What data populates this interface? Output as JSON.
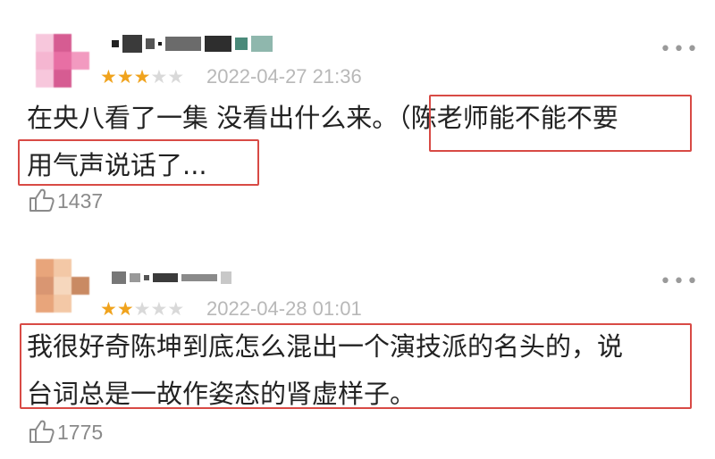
{
  "reviews": [
    {
      "stars_filled": 3,
      "stars_total": 5,
      "date": "2022-04-27 21:36",
      "text_line1": "在央八看了一集 没看出什么来。（陈老师能不能不要",
      "text_line2": "用气声说话了...",
      "likes": "1437",
      "more_label": "•••",
      "avatar_colors": [
        "#f7c7dc",
        "#f29ac0",
        "#e86fa4",
        "#f5b6d1",
        "#ee86b4",
        "#d65c92"
      ],
      "name_mosaic_colors": [
        "#222222",
        "#3a3a3a",
        "#555555",
        "#1a1a1a",
        "#6b6b6b",
        "#2e2e2e",
        "#4a8a7a",
        "#8fb7ad"
      ]
    },
    {
      "stars_filled": 2,
      "stars_total": 5,
      "date": "2022-04-28 01:01",
      "text_line1": "我很好奇陈坤到底怎么混出一个演技派的名头的，说",
      "text_line2": "台词总是一故作姿态的肾虚样子。",
      "likes": "1775",
      "more_label": "•••",
      "avatar_colors": [
        "#f3c8a6",
        "#e8a57b",
        "#c98a63",
        "#f6d7bd",
        "#d99672",
        "#b7775a"
      ],
      "name_mosaic_colors": [
        "#777777",
        "#999999",
        "#555555",
        "#3b3b3b",
        "#8a8a8a",
        "#c8c8c8"
      ]
    }
  ],
  "highlight_color": "#d84a45",
  "star_color": "#f0a31d"
}
